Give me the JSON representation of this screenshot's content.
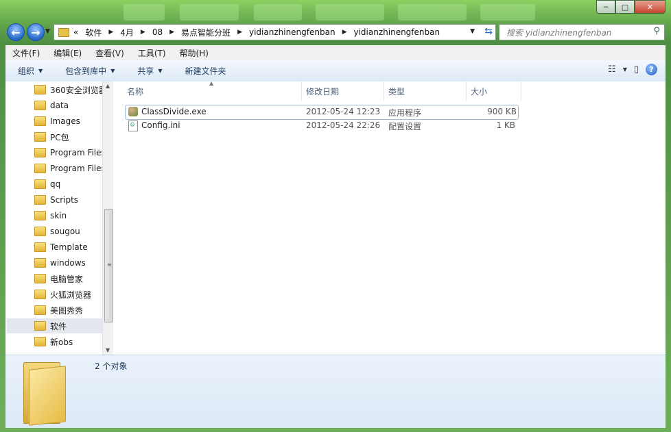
{
  "window": {
    "title_glow_tabs": [
      "tab1",
      "tab2",
      "tab3",
      "tab4",
      "tab5",
      "tab6"
    ],
    "controls": {
      "minimize": "─",
      "maximize": "□",
      "close": "✕"
    }
  },
  "address": {
    "overflow": "«",
    "crumbs": [
      "软件",
      "4月",
      "08",
      "易点智能分班",
      "yidianzhinengfenban",
      "yidianzhinengfenban"
    ],
    "separator": "▶"
  },
  "search": {
    "placeholder": "搜索 yidianzhinengfenban"
  },
  "menubar": {
    "items": [
      "文件(F)",
      "编辑(E)",
      "查看(V)",
      "工具(T)",
      "帮助(H)"
    ]
  },
  "commandbar": {
    "organize": "组织",
    "include_library": "包含到库中",
    "share": "共享",
    "new_folder": "新建文件夹"
  },
  "nav": {
    "items": [
      "360安全浏览器",
      "data",
      "Images",
      "PC包",
      "Program Files",
      "Program Files",
      "qq",
      "Scripts",
      "skin",
      "sougou",
      "Template",
      "windows",
      "电脑管家",
      "火狐浏览器",
      "美图秀秀",
      "软件",
      "新obs"
    ],
    "selected": "软件"
  },
  "columns": {
    "name": "名称",
    "modified": "修改日期",
    "type": "类型",
    "size": "大小"
  },
  "files": [
    {
      "name": "ClassDivide.exe",
      "modified": "2012-05-24 12:23",
      "type": "应用程序",
      "size": "900 KB",
      "icon": "exe-icon"
    },
    {
      "name": "Config.ini",
      "modified": "2012-05-24 22:26",
      "type": "配置设置",
      "size": "1 KB",
      "icon": "ini-icon"
    }
  ],
  "details": {
    "count": "2 个对象"
  }
}
